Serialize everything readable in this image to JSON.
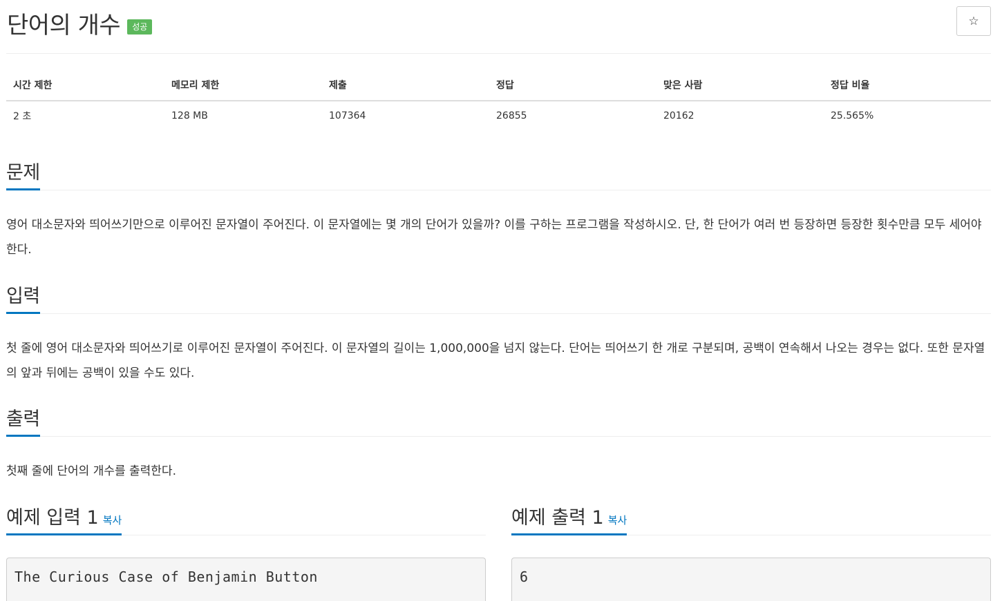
{
  "problem": {
    "title": "단어의 개수",
    "badge": "성공"
  },
  "star_icon": "☆",
  "info": {
    "headers": [
      "시간 제한",
      "메모리 제한",
      "제출",
      "정답",
      "맞은 사람",
      "정답 비율"
    ],
    "values": [
      "2 초",
      "128 MB",
      "107364",
      "26855",
      "20162",
      "25.565%"
    ]
  },
  "sections": {
    "description": {
      "title": "문제",
      "text": "영어 대소문자와 띄어쓰기만으로 이루어진 문자열이 주어진다. 이 문자열에는 몇 개의 단어가 있을까? 이를 구하는 프로그램을 작성하시오. 단, 한 단어가 여러 번 등장하면 등장한 횟수만큼 모두 세어야 한다."
    },
    "input": {
      "title": "입력",
      "text": "첫 줄에 영어 대소문자와 띄어쓰기로 이루어진 문자열이 주어진다. 이 문자열의 길이는 1,000,000을 넘지 않는다. 단어는 띄어쓰기 한 개로 구분되며, 공백이 연속해서 나오는 경우는 없다. 또한 문자열의 앞과 뒤에는 공백이 있을 수도 있다."
    },
    "output": {
      "title": "출력",
      "text": "첫째 줄에 단어의 개수를 출력한다."
    }
  },
  "samples": {
    "input": {
      "title": "예제 입력 1",
      "copy_label": "복사",
      "content": "The Curious Case of Benjamin Button"
    },
    "output": {
      "title": "예제 출력 1",
      "copy_label": "복사",
      "content": "6"
    }
  },
  "colors": {
    "accent": "#0076c0",
    "success": "#5cb85c"
  }
}
